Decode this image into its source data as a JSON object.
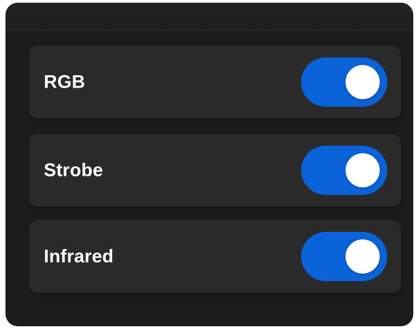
{
  "settings": {
    "items": [
      {
        "label": "RGB",
        "enabled": true
      },
      {
        "label": "Strobe",
        "enabled": true
      },
      {
        "label": "Infrared",
        "enabled": true
      }
    ]
  },
  "colors": {
    "toggle_on": "#0a63d8",
    "panel_bg": "#1c1c1c",
    "row_bg": "#2a2a2a",
    "text": "#ffffff"
  }
}
